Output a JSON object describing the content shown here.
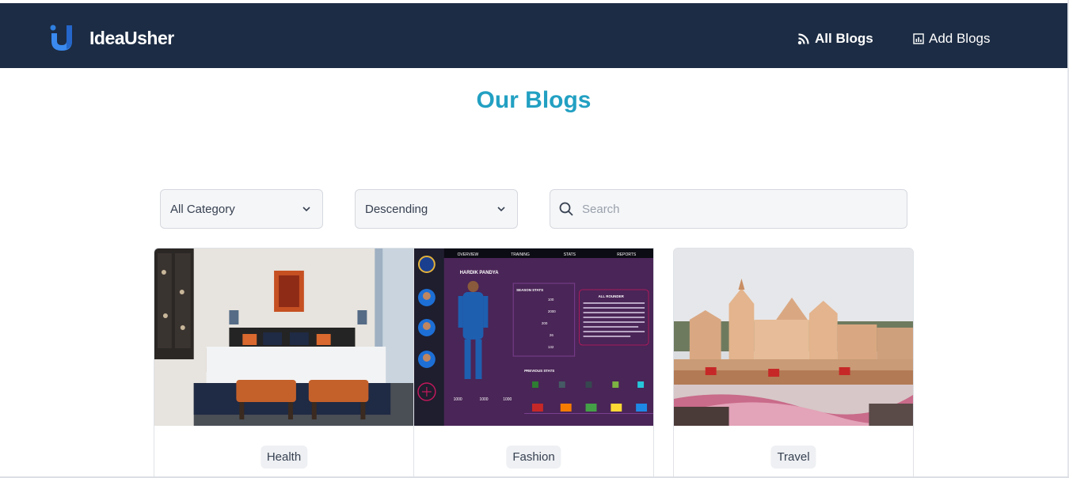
{
  "brand": {
    "name": "IdeaUsher",
    "colors": {
      "navbar": "#1c2c44",
      "accent": "#22a0c2",
      "logo": "#2f7fe0"
    }
  },
  "nav": {
    "all_blogs": "All Blogs",
    "add_blogs": "Add Blogs",
    "all_blogs_icon": "rss-icon",
    "add_blogs_icon": "chart-add-icon"
  },
  "page": {
    "title": "Our Blogs"
  },
  "filters": {
    "category": "All Category",
    "order": "Descending",
    "search_placeholder": "Search"
  },
  "blogs": [
    {
      "category": "Health",
      "image": "bedroom-photo"
    },
    {
      "category": "Fashion",
      "image": "cricket-player-stats-ui"
    },
    {
      "category": "Travel",
      "image": "temple-photo"
    }
  ],
  "fashion_image": {
    "tabs": [
      "OVERVIEW",
      "TRAINING",
      "STATS",
      "REPORTS"
    ],
    "player": "HARDIK PANDYA",
    "role": "ALL ROUNDER",
    "season_stats": "SEASON STATS",
    "previous_stats": "PREVIOUS STATS",
    "stat_values": [
      "100",
      "2000",
      "200",
      "26",
      "132"
    ],
    "bottom_values": [
      "1000",
      "1000",
      "1000"
    ]
  }
}
